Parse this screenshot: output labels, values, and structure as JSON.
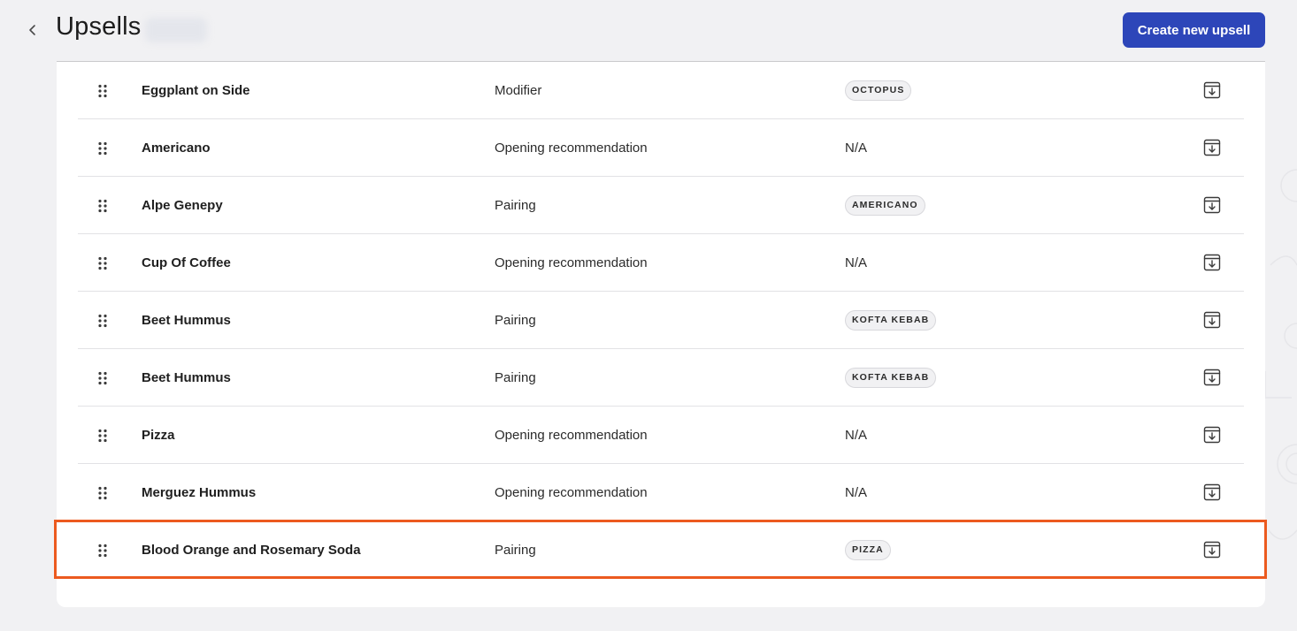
{
  "header": {
    "title": "Upsells",
    "create_button_label": "Create new upsell"
  },
  "colors": {
    "primary": "#2d46b9",
    "highlight": "#ec5a1f",
    "background": "#f1f1f3"
  },
  "rows": [
    {
      "name": "Eggplant on Side",
      "type": "Modifier",
      "trigger": "OCTOPUS",
      "trigger_kind": "tag"
    },
    {
      "name": "Americano",
      "type": "Opening recommendation",
      "trigger": "N/A",
      "trigger_kind": "text"
    },
    {
      "name": "Alpe Genepy",
      "type": "Pairing",
      "trigger": "AMERICANO",
      "trigger_kind": "tag"
    },
    {
      "name": "Cup Of Coffee",
      "type": "Opening recommendation",
      "trigger": "N/A",
      "trigger_kind": "text"
    },
    {
      "name": "Beet Hummus",
      "type": "Pairing",
      "trigger": "KOFTA KEBAB",
      "trigger_kind": "tag"
    },
    {
      "name": "Beet Hummus",
      "type": "Pairing",
      "trigger": "KOFTA KEBAB",
      "trigger_kind": "tag"
    },
    {
      "name": "Pizza",
      "type": "Opening recommendation",
      "trigger": "N/A",
      "trigger_kind": "text"
    },
    {
      "name": "Merguez Hummus",
      "type": "Opening recommendation",
      "trigger": "N/A",
      "trigger_kind": "text"
    },
    {
      "name": "Blood Orange and Rosemary Soda",
      "type": "Pairing",
      "trigger": "PIZZA",
      "trigger_kind": "tag",
      "highlighted": true
    }
  ],
  "icons": {
    "back": "chevron-left-icon",
    "drag": "drag-handle-icon",
    "archive": "archive-icon"
  }
}
